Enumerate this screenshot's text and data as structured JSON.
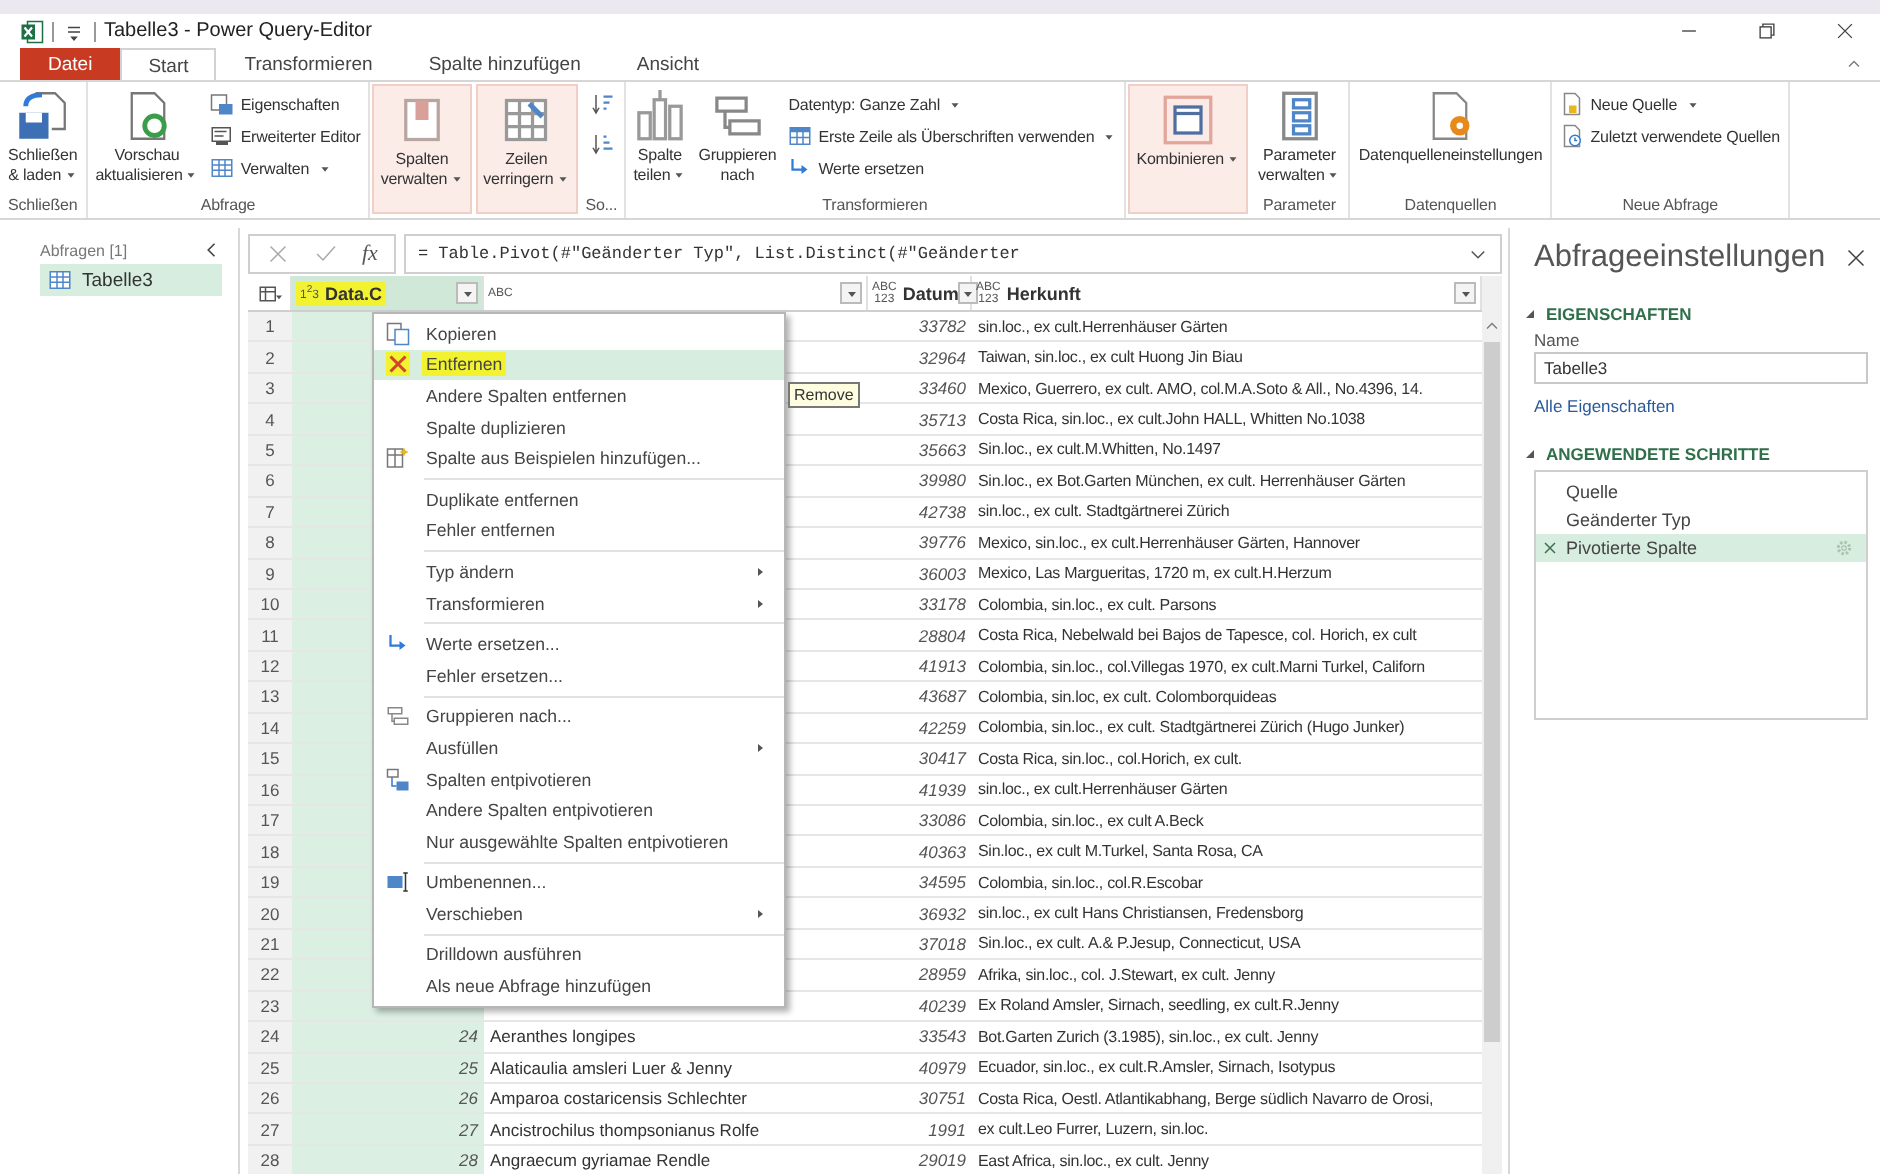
{
  "title_bar": {
    "title": "Tabelle3 - Power Query-Editor"
  },
  "tabs": [
    {
      "label": "Datei",
      "kind": "file",
      "selected": false
    },
    {
      "label": "Start",
      "kind": "tab",
      "selected": true
    },
    {
      "label": "Transformieren",
      "kind": "tab",
      "selected": false
    },
    {
      "label": "Spalte hinzufügen",
      "kind": "tab",
      "selected": false
    },
    {
      "label": "Ansicht",
      "kind": "tab",
      "selected": false
    }
  ],
  "ribbon": {
    "groups": [
      {
        "label": "Schließen",
        "kind": "normal",
        "items": [
          {
            "kind": "large",
            "label": "Schließen\n& laden",
            "dropdown": true
          }
        ]
      },
      {
        "label": "Abfrage",
        "kind": "normal",
        "items": [
          {
            "kind": "large",
            "label": "Vorschau\naktualisieren",
            "dropdown": true
          },
          {
            "kind": "stack",
            "buttons": [
              {
                "label": "Eigenschaften",
                "dropdown": false
              },
              {
                "label": "Erweiterter Editor",
                "dropdown": false
              },
              {
                "label": "Verwalten",
                "dropdown": true
              }
            ]
          }
        ]
      },
      {
        "kind": "collapsed",
        "items": [
          {
            "kind": "large",
            "label": "Spalten\nverwalten",
            "dropdown": true
          }
        ]
      },
      {
        "kind": "collapsed",
        "items": [
          {
            "kind": "large",
            "label": "Zeilen\nverringern",
            "dropdown": true
          }
        ]
      },
      {
        "label": "So...",
        "kind": "normal",
        "items": [
          {
            "kind": "sort"
          }
        ]
      },
      {
        "label": "Transformieren",
        "kind": "normal",
        "items": [
          {
            "kind": "large",
            "label": "Spalte\nteilen",
            "dropdown": true
          },
          {
            "kind": "large",
            "label": "Gruppieren\nnach",
            "dropdown": false
          },
          {
            "kind": "stack",
            "buttons": [
              {
                "label": "Datentyp: Ganze Zahl",
                "dropdown": true
              },
              {
                "label": "Erste Zeile als Überschriften verwenden",
                "dropdown": true
              },
              {
                "label": "Werte ersetzen",
                "dropdown": false
              }
            ]
          }
        ]
      },
      {
        "kind": "collapsed",
        "items": [
          {
            "kind": "large",
            "label": "Kombinieren",
            "dropdown": true
          }
        ]
      },
      {
        "label": "Parameter",
        "kind": "normal",
        "items": [
          {
            "kind": "large",
            "label": "Parameter\nverwalten",
            "dropdown": true
          }
        ]
      },
      {
        "label": "Datenquellen",
        "kind": "normal",
        "items": [
          {
            "kind": "large",
            "label": "Datenquelleneinstellungen",
            "dropdown": false
          }
        ]
      },
      {
        "label": "Neue Abfrage",
        "kind": "normal",
        "items": [
          {
            "kind": "stack",
            "buttons": [
              {
                "label": "Neue Quelle",
                "dropdown": true
              },
              {
                "label": "Zuletzt verwendete Quellen",
                "dropdown": false
              }
            ]
          }
        ]
      }
    ]
  },
  "queries_pane": {
    "title": "Abfragen [1]",
    "queries": [
      {
        "label": "Tabelle3",
        "selected": true
      }
    ]
  },
  "formula_bar": {
    "fx": "fx",
    "formula": "= Table.Pivot(#\"Geänderter Typ\", List.Distinct(#\"Geänderter"
  },
  "table": {
    "columns": [
      {
        "type_label": "1$^{2}$3",
        "title": "Data.C",
        "selected": true,
        "highlighted": true
      },
      {
        "type_label": "ABC",
        "selected": false,
        "highlighted": false
      },
      {
        "type_label": "ABC\n123",
        "title": "Datum",
        "selected": false,
        "highlighted": false
      },
      {
        "type_label": "ABC\n123",
        "title": "Herkunft",
        "selected": false,
        "highlighted": false
      }
    ],
    "rows": [
      {
        "n": "1",
        "datum": "33782",
        "herkunft": "sin.loc., ex cult.Herrenhäuser Gärten"
      },
      {
        "n": "2",
        "datum": "32964",
        "herkunft": "Taiwan, sin.loc., ex cult Huong Jin Biau"
      },
      {
        "n": "3",
        "datum": "33460",
        "herkunft": "Mexico, Guerrero, ex cult. AMO, col.M.A.Soto & All., No.4396, 14."
      },
      {
        "n": "4",
        "datum": "35713",
        "herkunft": "Costa Rica, sin.loc., ex cult.John HALL, Whitten No.1038"
      },
      {
        "n": "5",
        "datum": "35663",
        "herkunft": "Sin.loc., ex cult.M.Whitten, No.1497"
      },
      {
        "n": "6",
        "datum": "39980",
        "herkunft": "Sin.loc., ex Bot.Garten München, ex cult. Herrenhäuser Gärten"
      },
      {
        "n": "7",
        "datum": "42738",
        "herkunft": "sin.loc., ex cult. Stadtgärtnerei Zürich"
      },
      {
        "n": "8",
        "datum": "39776",
        "herkunft": "Mexico, sin.loc., ex cult.Herrenhäuser Gärten, Hannover"
      },
      {
        "n": "9",
        "datum": "36003",
        "herkunft": "Mexico, Las Margueritas, 1720 m, ex cult.H.Herzum"
      },
      {
        "n": "10",
        "datum": "33178",
        "herkunft": "Colombia, sin.loc., ex cult. Parsons"
      },
      {
        "n": "11",
        "datum": "28804",
        "herkunft": "Costa Rica, Nebelwald bei Bajos de Tapesce, col. Horich, ex cult"
      },
      {
        "n": "12",
        "datum": "41913",
        "herkunft": "Colombia, sin.loc., col.Villegas 1970, ex cult.Marni Turkel, Californ"
      },
      {
        "n": "13",
        "datum": "43687",
        "herkunft": "Colombia, sin.loc, ex cult. Colomborquideas"
      },
      {
        "n": "14",
        "datum": "42259",
        "herkunft": "Colombia, sin.loc., ex cult. Stadtgärtnerei Zürich (Hugo Junker)"
      },
      {
        "n": "15",
        "datum": "30417",
        "herkunft": "Costa Rica, sin.loc., col.Horich, ex cult."
      },
      {
        "n": "16",
        "datum": "41939",
        "herkunft": "sin.loc., ex cult.Herrenhäuser Gärten"
      },
      {
        "n": "17",
        "datum": "33086",
        "herkunft": "Colombia, sin.loc., ex cult A.Beck"
      },
      {
        "n": "18",
        "datum": "40363",
        "herkunft": "Sin.loc., ex cult M.Turkel, Santa Rosa, CA"
      },
      {
        "n": "19",
        "datum": "34595",
        "herkunft": "Colombia, sin.loc., col.R.Escobar"
      },
      {
        "n": "20",
        "datum": "36932",
        "herkunft": "sin.loc., ex cult Hans Christiansen, Fredensborg"
      },
      {
        "n": "21",
        "datum": "37018",
        "herkunft": "Sin.loc., ex cult. A.& P.Jesup, Connecticut, USA"
      },
      {
        "n": "22",
        "datum": "28959",
        "herkunft": "Afrika, sin.loc., col. J.Stewart, ex cult. Jenny"
      },
      {
        "n": "23",
        "datum": "40239",
        "herkunft": "Ex Roland Amsler, Sirnach, seedling, ex cult.R.Jenny"
      },
      {
        "n": "24",
        "data_c": "24",
        "name": "Aeranthes longipes",
        "datum": "33543",
        "herkunft": "Bot.Garten Zurich (3.1985), sin.loc., ex cult. Jenny"
      },
      {
        "n": "25",
        "data_c": "25",
        "name": "Alaticaulia amsleri Luer & Jenny",
        "datum": "40979",
        "herkunft": "Ecuador, sin.loc., ex cult.R.Amsler, Sirnach, Isotypus"
      },
      {
        "n": "26",
        "data_c": "26",
        "name": "Amparoa costaricensis Schlechter",
        "datum": "30751",
        "herkunft": "Costa Rica, Oestl. Atlantikabhang, Berge südlich Navarro de Orosi,"
      },
      {
        "n": "27",
        "data_c": "27",
        "name": "Ancistrochilus thompsonianus Rolfe",
        "datum": "1991",
        "herkunft": "ex cult.Leo Furrer, Luzern, sin.loc."
      },
      {
        "n": "28",
        "data_c": "28",
        "name": "Angraecum gyriamae Rendle",
        "datum": "29019",
        "herkunft": "East Africa, sin.loc., ex cult. Jenny"
      }
    ]
  },
  "context_menu": {
    "groups": [
      {
        "items": [
          {
            "label": "Kopieren",
            "submenu": false,
            "selected": false,
            "highlighted": false
          },
          {
            "label": "Entfernen",
            "submenu": false,
            "selected": true,
            "highlighted": true
          },
          {
            "label": "Andere Spalten entfernen",
            "submenu": false,
            "selected": false,
            "highlighted": false
          },
          {
            "label": "Spalte duplizieren",
            "submenu": false,
            "selected": false,
            "highlighted": false
          },
          {
            "label": "Spalte aus Beispielen hinzufügen...",
            "submenu": false,
            "selected": false,
            "highlighted": false
          }
        ]
      },
      {
        "items": [
          {
            "label": "Duplikate entfernen",
            "submenu": false,
            "selected": false,
            "highlighted": false
          },
          {
            "label": "Fehler entfernen",
            "submenu": false,
            "selected": false,
            "highlighted": false
          }
        ]
      },
      {
        "items": [
          {
            "label": "Typ ändern",
            "submenu": true,
            "selected": false,
            "highlighted": false
          },
          {
            "label": "Transformieren",
            "submenu": true,
            "selected": false,
            "highlighted": false
          }
        ]
      },
      {
        "items": [
          {
            "label": "Werte ersetzen...",
            "submenu": false,
            "selected": false,
            "highlighted": false
          },
          {
            "label": "Fehler ersetzen...",
            "submenu": false,
            "selected": false,
            "highlighted": false
          }
        ]
      },
      {
        "items": [
          {
            "label": "Gruppieren nach...",
            "submenu": false,
            "selected": false,
            "highlighted": false
          },
          {
            "label": "Ausfüllen",
            "submenu": true,
            "selected": false,
            "highlighted": false
          },
          {
            "label": "Spalten entpivotieren",
            "submenu": false,
            "selected": false,
            "highlighted": false
          },
          {
            "label": "Andere Spalten entpivotieren",
            "submenu": false,
            "selected": false,
            "highlighted": false
          },
          {
            "label": "Nur ausgewählte Spalten entpivotieren",
            "submenu": false,
            "selected": false,
            "highlighted": false
          }
        ]
      },
      {
        "items": [
          {
            "label": "Umbenennen...",
            "submenu": false,
            "selected": false,
            "highlighted": false
          },
          {
            "label": "Verschieben",
            "submenu": true,
            "selected": false,
            "highlighted": false
          }
        ]
      },
      {
        "items": [
          {
            "label": "Drilldown ausführen",
            "submenu": false,
            "selected": false,
            "highlighted": false
          },
          {
            "label": "Als neue Abfrage hinzufügen",
            "submenu": false,
            "selected": false,
            "highlighted": false
          }
        ]
      }
    ]
  },
  "tooltip": {
    "text": "Remove"
  },
  "settings_pane": {
    "title": "Abfrageeinstellungen",
    "properties": {
      "heading": "EIGENSCHAFTEN",
      "expanded": true,
      "name_label": "Name",
      "name_value": "Tabelle3",
      "link": "Alle Eigenschaften"
    },
    "steps": {
      "heading": "ANGEWENDETE SCHRITTE",
      "expanded": true,
      "items": [
        {
          "label": "Quelle",
          "selected": false,
          "has_settings": false
        },
        {
          "label": "Geänderter Typ",
          "selected": false,
          "has_settings": false
        },
        {
          "label": "Pivotierte Spalte",
          "selected": true,
          "has_settings": true
        }
      ]
    }
  }
}
